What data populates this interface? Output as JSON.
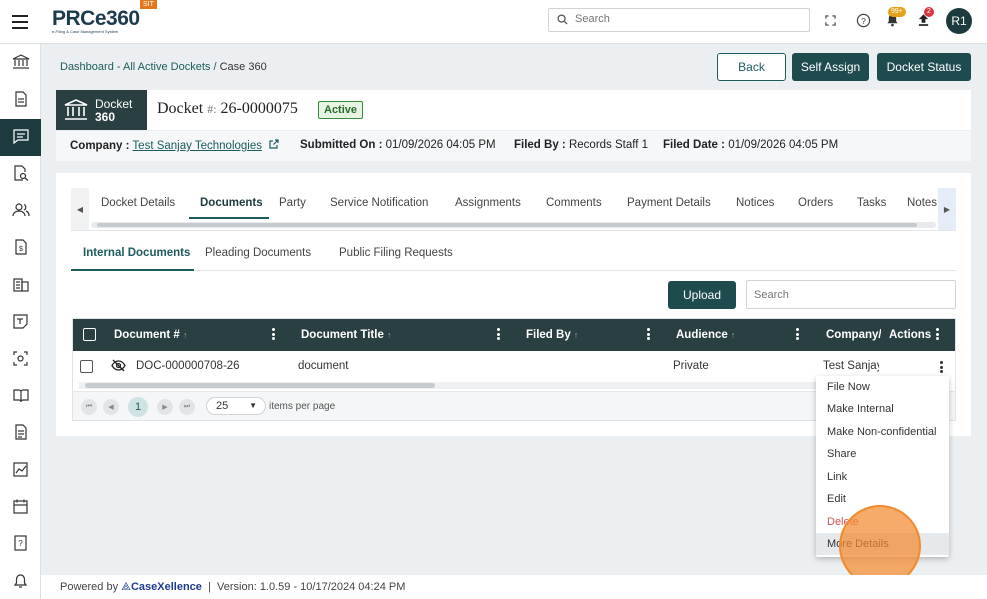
{
  "topbar": {
    "logo_text": "PRCe360",
    "logo_subtitle": "e-Filing & Case Management System",
    "env_badge": "SIT",
    "search_placeholder": "Search",
    "notifications_count": "99+",
    "uploads_count": "2",
    "avatar_initials": "R1",
    "icons": [
      "menu-icon",
      "fullscreen-icon",
      "help-icon",
      "bell-icon",
      "upload-icon"
    ]
  },
  "sidebar": {
    "icons": [
      "bank-icon",
      "document-icon",
      "chat-icon",
      "search-document-icon",
      "users-icon",
      "dollar-document-icon",
      "building-icon",
      "note-icon",
      "scan-face-icon",
      "book-icon",
      "file-icon",
      "chart-icon",
      "calendar-icon",
      "help-book-icon",
      "alarm-icon"
    ],
    "active_index": 2
  },
  "breadcrumb": {
    "link": "Dashboard - All Active Dockets",
    "separator": "/",
    "current": "Case 360"
  },
  "actions": {
    "back": "Back",
    "self_assign": "Self Assign",
    "docket_status": "Docket Status"
  },
  "docket": {
    "icon_label_1": "Docket",
    "icon_label_2": "360",
    "title_prefix": "Docket",
    "hash": "#:",
    "number": "26-0000075",
    "status": "Active"
  },
  "meta": {
    "company_label": "Company :",
    "company_value": "Test Sanjay Technologies",
    "submitted_label": "Submitted On :",
    "submitted_value": "01/09/2026 04:05 PM",
    "filed_by_label": "Filed By :",
    "filed_by_value": "Records Staff 1",
    "filed_date_label": "Filed Date :",
    "filed_date_value": "01/09/2026 04:05 PM"
  },
  "tabs": [
    "Docket Details",
    "Documents",
    "Party",
    "Service Notification",
    "Assignments",
    "Comments",
    "Payment Details",
    "Notices",
    "Orders",
    "Tasks",
    "Notes"
  ],
  "active_tab": "Documents",
  "subtabs": [
    "Internal Documents",
    "Pleading Documents",
    "Public Filing Requests"
  ],
  "upload_label": "Upload",
  "grid_search_placeholder": "Search",
  "grid": {
    "columns": [
      "Document #",
      "Document Title",
      "Filed By",
      "Audience",
      "Company/I",
      "Actions"
    ],
    "rows": [
      {
        "document_no": "DOC-000000708-26",
        "title": "document",
        "filed_by": "",
        "audience": "Private",
        "company": "Test Sanjay"
      }
    ]
  },
  "pager": {
    "current_page": "1",
    "per_page": "25",
    "per_page_label": "items per page"
  },
  "menu": {
    "items": [
      "File Now",
      "Make Internal",
      "Make Non-confidential",
      "Share",
      "Link",
      "Edit",
      "Delete",
      "More Details"
    ],
    "hovered": "More Details"
  },
  "footer": {
    "powered_by": "Powered by",
    "brand": "CaseXellence",
    "separator": "|",
    "version": "Version: 1.0.59 - 10/17/2024 04:24 PM"
  }
}
